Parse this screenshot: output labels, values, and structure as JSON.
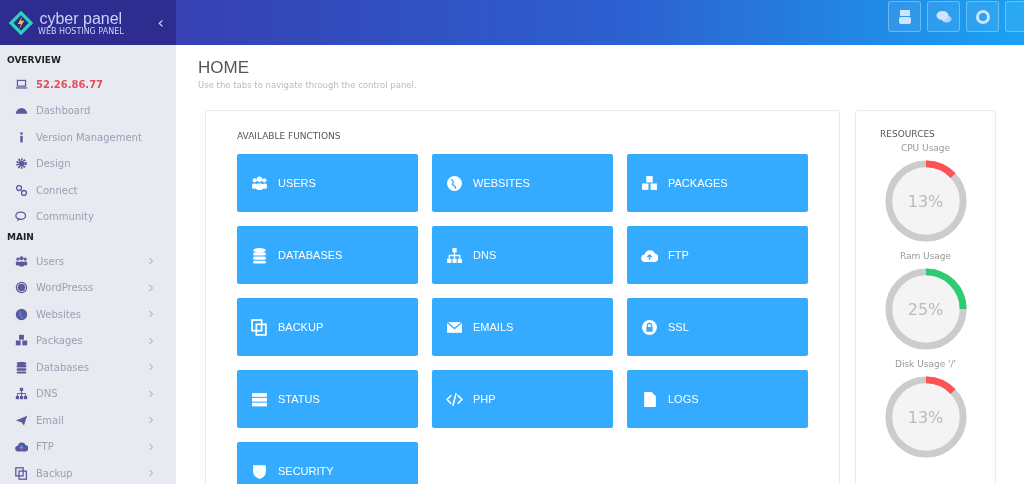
{
  "brand": {
    "name": "cyber panel",
    "tagline": "WEB HOSTING PANEL",
    "collapse": "‹"
  },
  "sidebar": {
    "sections": [
      {
        "heading": "OVERVIEW",
        "items": [
          {
            "label": "52.26.86.77",
            "kind": "ip",
            "expandable": false
          },
          {
            "label": "Dashboard",
            "kind": "link",
            "expandable": false
          },
          {
            "label": "Version Management",
            "kind": "link",
            "expandable": false
          },
          {
            "label": "Design",
            "kind": "link",
            "expandable": false
          },
          {
            "label": "Connect",
            "kind": "link",
            "expandable": false
          },
          {
            "label": "Community",
            "kind": "link",
            "expandable": false
          }
        ]
      },
      {
        "heading": "MAIN",
        "items": [
          {
            "label": "Users",
            "kind": "link",
            "expandable": true
          },
          {
            "label": "WordPresss",
            "kind": "link",
            "expandable": true
          },
          {
            "label": "Websites",
            "kind": "link",
            "expandable": true
          },
          {
            "label": "Packages",
            "kind": "link",
            "expandable": true
          },
          {
            "label": "Databases",
            "kind": "link",
            "expandable": true
          },
          {
            "label": "DNS",
            "kind": "link",
            "expandable": true
          },
          {
            "label": "Email",
            "kind": "link",
            "expandable": true
          },
          {
            "label": "FTP",
            "kind": "link",
            "expandable": true
          },
          {
            "label": "Backup",
            "kind": "link",
            "expandable": true
          }
        ]
      }
    ]
  },
  "page": {
    "title": "HOME",
    "subtitle": "Use the tabs to navigate through the control panel."
  },
  "functions": {
    "heading": "AVAILABLE FUNCTIONS",
    "tiles": [
      "USERS",
      "WEBSITES",
      "PACKAGES",
      "DATABASES",
      "DNS",
      "FTP",
      "BACKUP",
      "EMAILS",
      "SSL",
      "STATUS",
      "PHP",
      "LOGS",
      "SECURITY"
    ]
  },
  "resources": {
    "heading": "RESOURCES",
    "gauges": [
      {
        "label": "CPU Usage",
        "reading": "13%",
        "level": 0.13,
        "color": "#ff5252"
      },
      {
        "label": "Ram Usage",
        "reading": "25%",
        "level": 0.25,
        "color": "#2ecc71"
      },
      {
        "label": "Disk Usage '/'",
        "reading": "13%",
        "level": 0.13,
        "color": "#ff5252"
      }
    ]
  }
}
